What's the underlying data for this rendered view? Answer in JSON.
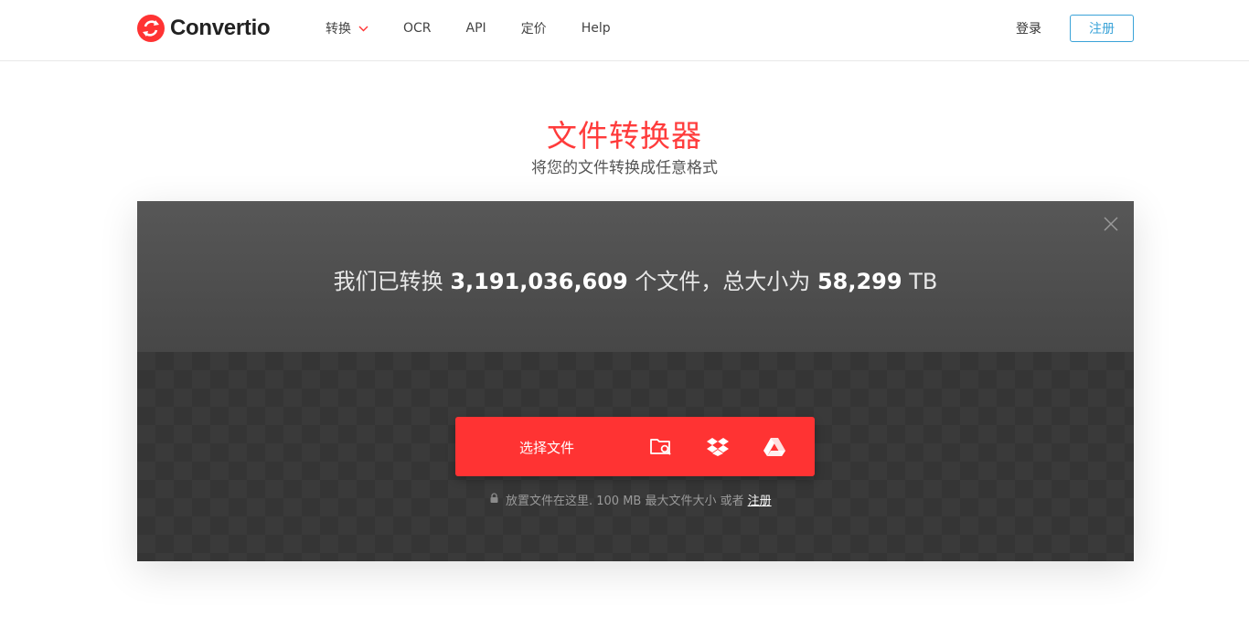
{
  "header": {
    "brand": "Convertio",
    "nav": [
      {
        "label": "转换",
        "icon": "chevron-down-icon"
      },
      {
        "label": "OCR"
      },
      {
        "label": "API"
      },
      {
        "label": "定价"
      },
      {
        "label": "Help"
      }
    ],
    "login_label": "登录",
    "signup_label": "注册"
  },
  "hero": {
    "title": "文件转换器",
    "subtitle": "将您的文件转换成任意格式"
  },
  "stats": {
    "prefix": "我们已转换",
    "files_count": "3,191,036,609",
    "middle": "个文件，总大小为",
    "total_size": "58,299",
    "unit": "TB"
  },
  "upload": {
    "choose_label": "选择文件",
    "sources": [
      {
        "icon": "folder-search-icon"
      },
      {
        "icon": "dropbox-icon"
      },
      {
        "icon": "google-drive-icon"
      }
    ],
    "note_text": "放置文件在这里. 100 MB 最大文件大小 或者",
    "note_link": "注册"
  },
  "colors": {
    "accent": "#ff3333",
    "signup_border": "#3aa3d8",
    "panel_bg": "#3d3d3d"
  }
}
